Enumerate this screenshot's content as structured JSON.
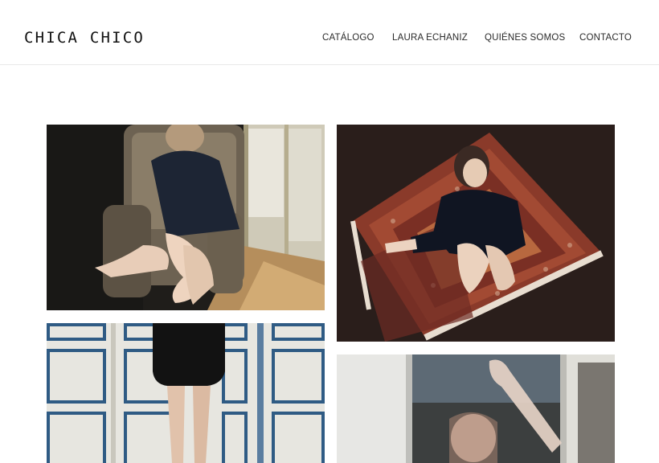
{
  "site": {
    "logo": "CHICA CHICO"
  },
  "nav": {
    "items": [
      {
        "label": "CATÁLOGO"
      },
      {
        "label": "LAURA ECHANIZ"
      },
      {
        "label": "QUIÉNES SOMOS"
      },
      {
        "label": "CONTACTO"
      }
    ]
  },
  "gallery": {
    "photos": [
      {
        "subject": "woman-in-armchair-photo"
      },
      {
        "subject": "woman-on-rug-photo"
      },
      {
        "subject": "legs-by-doors-photo"
      },
      {
        "subject": "reflection-window-photo"
      }
    ]
  },
  "colors": {
    "background": "#ffffff",
    "text": "#222222",
    "header_border": "#e9e9e9"
  }
}
